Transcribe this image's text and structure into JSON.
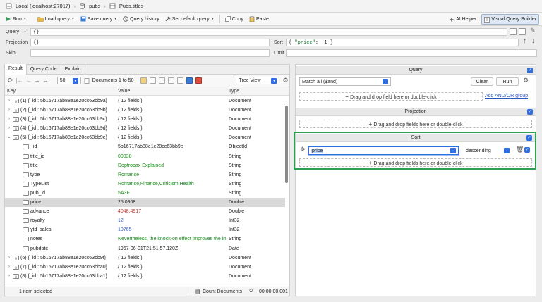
{
  "breadcrumb": {
    "connection": "Local (localhost:27017)",
    "database": "pubs",
    "collection": "Pubs.titles"
  },
  "toolbar": {
    "run": "Run",
    "load_query": "Load query",
    "save_query": "Save query",
    "query_history": "Query history",
    "set_default_query": "Set default query",
    "copy": "Copy",
    "paste": "Paste",
    "ai_helper": "AI Helper",
    "visual_query_builder": "Visual Query Builder"
  },
  "query": {
    "query_label": "Query",
    "query_value": "{}",
    "projection_label": "Projection",
    "projection_value": "{}",
    "sort_label": "Sort",
    "sort_key": "\"price\"",
    "sort_rest": ": -1 }",
    "sort_open": "{ ",
    "skip_label": "Skip",
    "limit_label": "Limit"
  },
  "tabs": [
    "Result",
    "Query Code",
    "Explain"
  ],
  "results": {
    "page_size": "50",
    "documents_label": "Documents 1 to 50",
    "view_mode": "Tree View",
    "columns": {
      "key": "Key",
      "value": "Value",
      "type": "Type"
    },
    "rows": [
      {
        "key": "(1) {_id : 5b16717ab88e1e20cc63bb9a}",
        "value": "{ 12 fields }",
        "type": "Document",
        "exp": "›",
        "indent": 0,
        "color": ""
      },
      {
        "key": "(2) {_id : 5b16717ab88e1e20cc63bb9b}",
        "value": "{ 12 fields }",
        "type": "Document",
        "exp": "›",
        "indent": 0,
        "color": ""
      },
      {
        "key": "(3) {_id : 5b16717ab88e1e20cc63bb9c}",
        "value": "{ 12 fields }",
        "type": "Document",
        "exp": "›",
        "indent": 0,
        "color": ""
      },
      {
        "key": "(4) {_id : 5b16717ab88e1e20cc63bb9d}",
        "value": "{ 12 fields }",
        "type": "Document",
        "exp": "›",
        "indent": 0,
        "color": ""
      },
      {
        "key": "(5) {_id : 5b16717ab88e1e20cc63bb9e}",
        "value": "{ 12 fields }",
        "type": "Document",
        "exp": "⌄",
        "indent": 0,
        "color": ""
      },
      {
        "key": "_id",
        "value": "5b16717ab88e1e20cc63bb9e",
        "type": "ObjectId",
        "exp": "",
        "indent": 1,
        "color": ""
      },
      {
        "key": "title_id",
        "value": "00038",
        "type": "String",
        "exp": "",
        "indent": 1,
        "color": "green"
      },
      {
        "key": "title",
        "value": "Dopfropax Explained",
        "type": "String",
        "exp": "",
        "indent": 1,
        "color": "green"
      },
      {
        "key": "type",
        "value": "Romance",
        "type": "String",
        "exp": "",
        "indent": 1,
        "color": "green"
      },
      {
        "key": "TypeList",
        "value": "Romance,Finance,Criticism,Health",
        "type": "String",
        "exp": "",
        "indent": 1,
        "color": "green"
      },
      {
        "key": "pub_id",
        "value": "5A3F",
        "type": "String",
        "exp": "",
        "indent": 1,
        "color": "green"
      },
      {
        "key": "price",
        "value": "25.0968",
        "type": "Double",
        "exp": "",
        "indent": 1,
        "color": "",
        "selected": true
      },
      {
        "key": "advance",
        "value": "4048.4917",
        "type": "Double",
        "exp": "",
        "indent": 1,
        "color": "red"
      },
      {
        "key": "royalty",
        "value": "12",
        "type": "Int32",
        "exp": "",
        "indent": 1,
        "color": "blue"
      },
      {
        "key": "ytd_sales",
        "value": "10765",
        "type": "Int32",
        "exp": "",
        "indent": 1,
        "color": "blue"
      },
      {
        "key": "notes",
        "value": "Nevertheless, the knock-on effect improves the im",
        "type": "String",
        "exp": "",
        "indent": 1,
        "color": "green"
      },
      {
        "key": "pubdate",
        "value": "1967-06-01T21:51:57.120Z",
        "type": "Date",
        "exp": "",
        "indent": 1,
        "color": ""
      },
      {
        "key": "(6) {_id : 5b16717ab88e1e20cc63bb9f}",
        "value": "{ 12 fields }",
        "type": "Document",
        "exp": "›",
        "indent": 0,
        "color": ""
      },
      {
        "key": "(7) {_id : 5b16717ab88e1e20cc63bba0}",
        "value": "{ 12 fields }",
        "type": "Document",
        "exp": "›",
        "indent": 0,
        "color": ""
      },
      {
        "key": "(8) {_id : 5b16717ab88e1e20cc63bba1}",
        "value": "{ 12 fields }",
        "type": "Document",
        "exp": "›",
        "indent": 0,
        "color": ""
      }
    ],
    "status": {
      "selected": "1 item selected",
      "count_documents": "Count Documents",
      "elapsed": "00:00:00.001"
    }
  },
  "builder": {
    "query_title": "Query",
    "match_value": "Match all ($and)",
    "clear": "Clear",
    "run": "Run",
    "add_andor": "Add AND/OR group",
    "dropzone": "Drag and drop fields here or double-click",
    "dropzone_single": "Drag and drop field here or double-click",
    "projection_title": "Projection",
    "sort_title": "Sort",
    "sort_field": "price",
    "sort_order": "descending"
  },
  "colors": {
    "accent": "#2d6ee0",
    "highlight_green": "#2e9e4f",
    "string_green": "#1a8a1a"
  }
}
